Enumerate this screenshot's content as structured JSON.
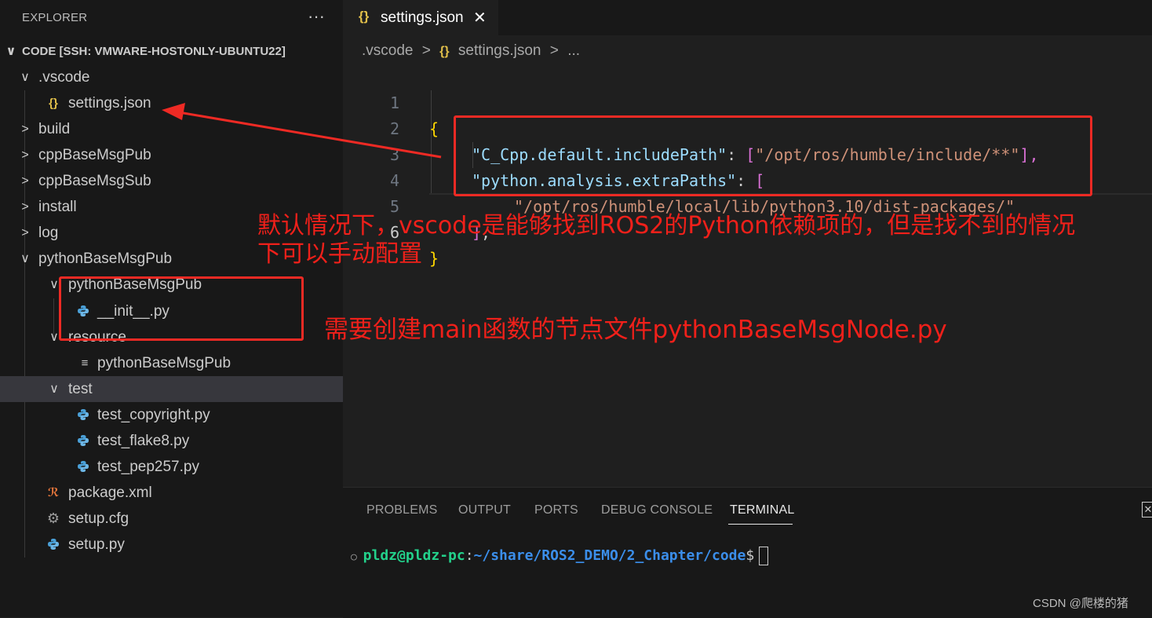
{
  "explorer": {
    "title": "EXPLORER",
    "menu": "···",
    "root": "CODE [SSH: VMWARE-HOSTONLY-UBUNTU22]",
    "items": [
      {
        "label": ".vscode",
        "chev": "∨"
      },
      {
        "label": "settings.json",
        "icon": "{}"
      },
      {
        "label": "build",
        "chev": ">"
      },
      {
        "label": "cppBaseMsgPub",
        "chev": ">"
      },
      {
        "label": "cppBaseMsgSub",
        "chev": ">"
      },
      {
        "label": "install",
        "chev": ">"
      },
      {
        "label": "log",
        "chev": ">"
      },
      {
        "label": "pythonBaseMsgPub",
        "chev": "∨"
      },
      {
        "label": "pythonBaseMsgPub",
        "chev": "∨"
      },
      {
        "label": "__init__.py"
      },
      {
        "label": "resource",
        "chev": "∨"
      },
      {
        "label": "pythonBaseMsgPub"
      },
      {
        "label": "test",
        "chev": "∨"
      },
      {
        "label": "test_copyright.py"
      },
      {
        "label": "test_flake8.py"
      },
      {
        "label": "test_pep257.py"
      },
      {
        "label": "package.xml"
      },
      {
        "label": "setup.cfg"
      },
      {
        "label": "setup.py"
      }
    ]
  },
  "editor": {
    "tab_label": "settings.json",
    "tab_icon": "{}",
    "tab_close": "✕",
    "breadcrumb": [
      ".vscode",
      ">",
      "{}",
      "settings.json",
      ">",
      "..."
    ],
    "lines": [
      {
        "n": "1",
        "text": "{"
      },
      {
        "n": "2",
        "key": "\"C_Cpp.default.includePath\"",
        "sep": ": ",
        "b": "[",
        "val": "\"/opt/ros/humble/include/**\"",
        "end": "],"
      },
      {
        "n": "3",
        "key": "\"python.analysis.extraPaths\"",
        "sep": ": ",
        "b": "["
      },
      {
        "n": "4",
        "val": "\"/opt/ros/humble/local/lib/python3.10/dist-packages/\""
      },
      {
        "n": "5",
        "b": "]",
        "end": ","
      },
      {
        "n": "6",
        "text": "}"
      }
    ]
  },
  "panel": {
    "tabs": [
      "PROBLEMS",
      "OUTPUT",
      "PORTS",
      "DEBUG CONSOLE",
      "TERMINAL"
    ],
    "active_tab": "TERMINAL",
    "close": "✕",
    "terminal": {
      "user": "pldz@pldz-pc",
      "colon": ":",
      "path": "~/share/ROS2_DEMO/2_Chapter/code",
      "prompt": "$"
    }
  },
  "annotations": {
    "note1_line1": "默认情况下，vscode是能够找到ROS2的Python依赖项的，但是找不到的情况",
    "note1_line2": "下可以手动配置",
    "note2": "需要创建main函数的节点文件pythonBaseMsgNode.py",
    "color": "#ee2a24"
  },
  "watermark": "CSDN @爬楼的猪"
}
